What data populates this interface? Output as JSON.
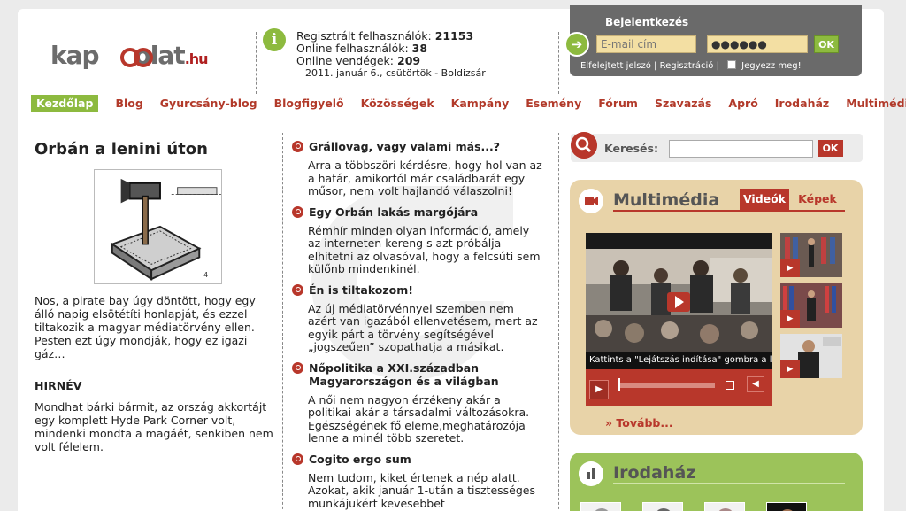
{
  "header": {
    "logo_main": "kapcsolat",
    "logo_suffix": ".hu",
    "stats": {
      "registered_label": "Regisztrált felhasználók:",
      "registered_value": "21153",
      "online_users_label": "Online felhasználók:",
      "online_users_value": "38",
      "online_guests_label": "Online vendégek:",
      "online_guests_value": "209",
      "date": "2011. január 6., csütörtök - Boldizsár"
    }
  },
  "login": {
    "title": "Bejelentkezés",
    "email_placeholder": "E-mail cím",
    "password_value": "●●●●●●",
    "ok_label": "OK",
    "forgot_label": "Elfelejtett jelszó",
    "register_label": "Regisztráció",
    "remember_label": "Jegyezz meg!"
  },
  "nav": {
    "items": [
      "Kezdőlap",
      "Blog",
      "Gyurcsány-blog",
      "Blogfigyelő",
      "Közösségek",
      "Kampány",
      "Esemény",
      "Fórum",
      "Szavazás",
      "Apró",
      "Irodaház",
      "Multimédia"
    ]
  },
  "article": {
    "title": "Orbán a lenini úton",
    "lead": "Nos, a pirate bay úgy döntött, hogy egy álló napig elsötétíti honlapját, és ezzel tiltakozik a magyar médiatörvény ellen. Pesten ezt úgy mondják, hogy ez igazi gáz…",
    "section_title": "HIRNÉV",
    "section_text": "Mondhat bárki bármit, az ország akkortájt egy komplett Hyde Park Corner volt, mindenki mondta a magáét, senkiben nem volt félelem."
  },
  "blog": {
    "items": [
      {
        "title": "Grállovag, vagy valami más...?",
        "text": "Arra a többszöri kérdésre, hogy hol van az a határ, amikortól már családbarát egy műsor, nem volt hajlandó válaszolni!"
      },
      {
        "title": "Egy Orbán lakás margójára",
        "text": "Rémhír minden olyan információ, amely az interneten kereng s azt próbálja elhitetni az olvasóval, hogy a felcsúti sem külőnb mindenkinél."
      },
      {
        "title": "Én is tiltakozom!",
        "text": "Az új médiatörvénnyel szemben nem azért van igazából ellenvetésem, mert az egyik párt a törvény segítségével „jogszeűen” szopathatja a másikat."
      },
      {
        "title": "Nőpolitika a XXI.században Magyarországon és a világban",
        "text": "A női nem nagyon érzékeny akár a politikai akár a társadalmi változásokra. Egészségének fő eleme,meghatározója lenne a minél több szeretet."
      },
      {
        "title": "Cogito ergo sum",
        "text": "Nem tudom, kiket értenek a nép alatt. Azokat, akik január 1-után a tisztességes munkájukért kevesebbet"
      }
    ]
  },
  "search": {
    "label": "Keresés:",
    "ok_label": "OK"
  },
  "multimedia": {
    "title": "Multimédia",
    "tab_videos": "Videók",
    "tab_images": "Képek",
    "caption": "Kattints a \"Lejátszás indítása\" gombra a l",
    "more_label": "» Tovább..."
  },
  "office": {
    "title": "Irodaház"
  }
}
